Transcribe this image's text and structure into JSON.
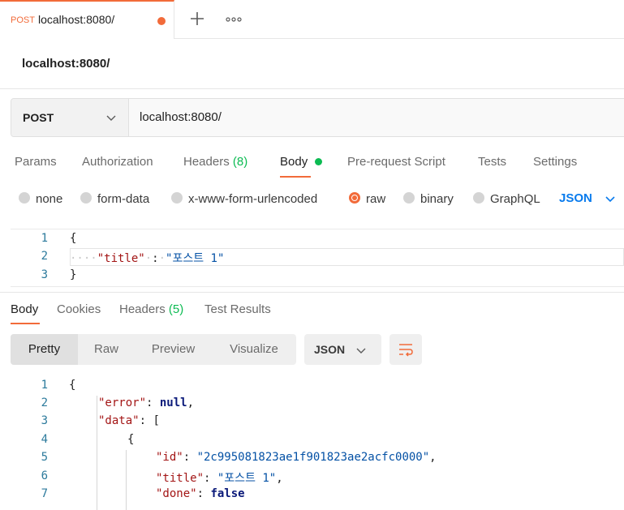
{
  "tab": {
    "method": "POST",
    "title": "localhost:8080/"
  },
  "icons": {
    "new_tab": "plus-icon",
    "more": "more-icon",
    "chevron": "chevron-down-icon",
    "wrap": "wrap-lines-icon"
  },
  "colors": {
    "accent": "#f26b3a",
    "green": "#0cbb52",
    "link_blue": "#097bed"
  },
  "request": {
    "title": "localhost:8080/",
    "method": "POST",
    "url": "localhost:8080/",
    "tabs": {
      "params": "Params",
      "authorization": "Authorization",
      "headers": "Headers",
      "headers_count": "(8)",
      "body": "Body",
      "prerequest": "Pre-request Script",
      "tests": "Tests",
      "settings": "Settings"
    },
    "body_types": {
      "none": "none",
      "form_data": "form-data",
      "urlencoded": "x-www-form-urlencoded",
      "raw": "raw",
      "binary": "binary",
      "graphql": "GraphQL",
      "selected": "raw"
    },
    "language": "JSON",
    "editor": {
      "line_numbers": [
        "1",
        "2",
        "3"
      ],
      "open_brace": "{",
      "key": "\"title\"",
      "colon": ":",
      "value": "\"포스트 1\"",
      "close_brace": "}"
    }
  },
  "response": {
    "tabs": {
      "body": "Body",
      "cookies": "Cookies",
      "headers": "Headers",
      "headers_count": "(5)",
      "test_results": "Test Results"
    },
    "views": {
      "pretty": "Pretty",
      "raw": "Raw",
      "preview": "Preview",
      "visualize": "Visualize"
    },
    "format": "JSON",
    "line_numbers": [
      "1",
      "2",
      "3",
      "4",
      "5",
      "6",
      "7"
    ],
    "code": {
      "open_brace": "{",
      "error_key": "\"error\"",
      "error_value": "null",
      "data_key": "\"data\"",
      "open_bracket": "[",
      "item_open": "{",
      "id_key": "\"id\"",
      "id_value": "\"2c995081823ae1f901823ae2acfc0000\"",
      "title_key": "\"title\"",
      "title_value": "\"포스트 1\"",
      "done_key": "\"done\"",
      "done_value": "false"
    }
  }
}
